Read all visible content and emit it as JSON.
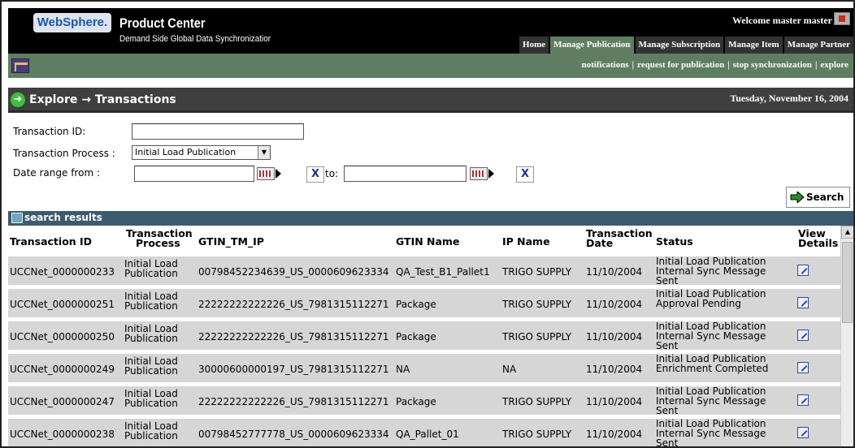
{
  "header": {
    "logo": "WebSphere.",
    "product": "Product Center",
    "subtitle": "Demand Side Global Data Synchronizatior",
    "welcome": "Welcome master master",
    "nav": [
      "Home",
      "Manage Publication",
      "Manage Subscription",
      "Manage Item",
      "Manage Partner"
    ],
    "active_nav": "Manage Publication"
  },
  "subnav": {
    "links": [
      "notifications",
      "request for publication",
      "stop synchronization",
      "explore"
    ]
  },
  "page": {
    "crumb_from": "Explore",
    "crumb_sep": "→",
    "crumb_to": "Transactions",
    "date": "Tuesday, November 16, 2004"
  },
  "form": {
    "txn_id_label": "Transaction ID:",
    "txn_id_value": "",
    "process_label": "Transaction Process :",
    "process_value": "Initial Load Publication",
    "date_from_label": "Date range from :",
    "date_from_value": "",
    "to_label": "to:",
    "date_to_value": "",
    "clear_label": "X",
    "search_label": "Search"
  },
  "results": {
    "title": "search results",
    "columns": {
      "id": "Transaction ID",
      "process_1": "Transaction",
      "process_2": "Process",
      "gtin_tm_ip": "GTIN_TM_IP",
      "gtin_name": "GTIN Name",
      "ip_name": "IP Name",
      "date_1": "Transaction",
      "date_2": "Date",
      "status": "Status",
      "view_1": "View",
      "view_2": "Details"
    },
    "rows": [
      {
        "id": "UCCNet_0000000233",
        "p1": "Initial Load",
        "p2": "Publication",
        "gtin": "00798452234639_US_0000609623334",
        "name": "QA_Test_B1_Pallet1",
        "ip": "TRIGO SUPPLY",
        "date": "11/10/2004",
        "s1": "Initial Load Publication",
        "s2": "Internal Sync Message",
        "s3": "Sent"
      },
      {
        "id": "UCCNet_0000000251",
        "p1": "Initial Load",
        "p2": "Publication",
        "gtin": "22222222222226_US_7981315112271",
        "name": "Package",
        "ip": "TRIGO SUPPLY",
        "date": "11/10/2004",
        "s1": "Initial Load Publication",
        "s2": "Approval Pending",
        "s3": ""
      },
      {
        "id": "UCCNet_0000000250",
        "p1": "Initial Load",
        "p2": "Publication",
        "gtin": "22222222222226_US_7981315112271",
        "name": "Package",
        "ip": "TRIGO SUPPLY",
        "date": "11/10/2004",
        "s1": "Initial Load Publication",
        "s2": "Internal Sync Message",
        "s3": "Sent"
      },
      {
        "id": "UCCNet_0000000249",
        "p1": "Initial Load",
        "p2": "Publication",
        "gtin": "30000600000197_US_7981315112271",
        "name": "NA",
        "ip": "NA",
        "date": "11/10/2004",
        "s1": "Initial Load Publication",
        "s2": "Enrichment Completed",
        "s3": ""
      },
      {
        "id": "UCCNet_0000000247",
        "p1": "Initial Load",
        "p2": "Publication",
        "gtin": "22222222222226_US_7981315112271",
        "name": "Package",
        "ip": "TRIGO SUPPLY",
        "date": "11/10/2004",
        "s1": "Initial Load Publication",
        "s2": "Internal Sync Message",
        "s3": "Sent"
      },
      {
        "id": "UCCNet_0000000238",
        "p1": "Initial Load",
        "p2": "Publication",
        "gtin": "00798452777778_US_0000609623334",
        "name": "QA_Pallet_01",
        "ip": "TRIGO SUPPLY",
        "date": "11/10/2004",
        "s1": "Initial Load Publication",
        "s2": "Internal Sync Message",
        "s3": "Sent"
      }
    ]
  }
}
